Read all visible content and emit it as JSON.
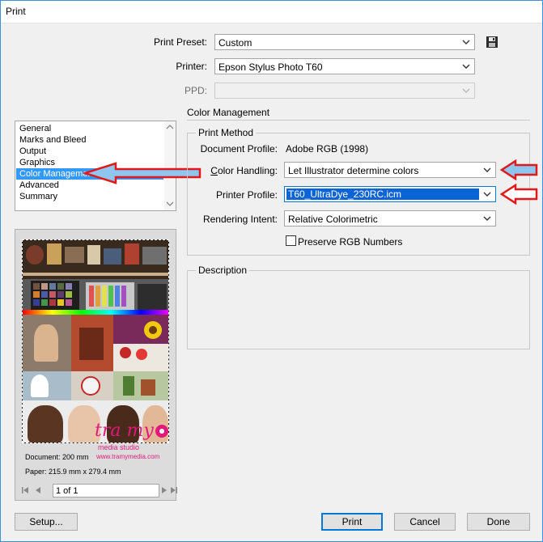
{
  "window": {
    "title": "Print"
  },
  "colors": {
    "accent": "#0078d7",
    "selection": "#3399ff",
    "annotation_arrow": "#e0191b"
  },
  "header": {
    "print_preset": {
      "label": "Print Preset:",
      "value": "Custom"
    },
    "printer": {
      "label": "Printer:",
      "value": "Epson Stylus Photo T60"
    },
    "ppd": {
      "label": "PPD:",
      "value": ""
    }
  },
  "section_title": "Color Management",
  "sidebar": {
    "items": [
      {
        "label": "General"
      },
      {
        "label": "Marks and Bleed"
      },
      {
        "label": "Output"
      },
      {
        "label": "Graphics"
      },
      {
        "label": "Color Management"
      },
      {
        "label": "Advanced"
      },
      {
        "label": "Summary"
      }
    ],
    "selected": "Color Management"
  },
  "print_method": {
    "title": "Print Method",
    "document_profile": {
      "label": "Document Profile:",
      "value": "Adobe RGB (1998)"
    },
    "color_handling": {
      "label": "Color Handling:",
      "value": "Let Illustrator determine colors"
    },
    "printer_profile": {
      "label": "Printer Profile:",
      "value": "T60_UltraDye_230RC.icm"
    },
    "rendering_intent": {
      "label": "Rendering Intent:",
      "value": "Relative Colorimetric"
    },
    "preserve_rgb": {
      "label": "Preserve RGB Numbers",
      "checked": false
    }
  },
  "description": {
    "title": "Description"
  },
  "preview": {
    "watermark_main": "tra my",
    "watermark_sub": "media studio",
    "watermark_url": "www.tramymedia.com",
    "document_info": "Document: 200 mm",
    "paper_info": "Paper: 215.9 mm x 279.4 mm",
    "page_field": "1 of 1"
  },
  "footer": {
    "setup_label": "Setup...",
    "print_label": "Print",
    "cancel_label": "Cancel",
    "done_label": "Done"
  }
}
